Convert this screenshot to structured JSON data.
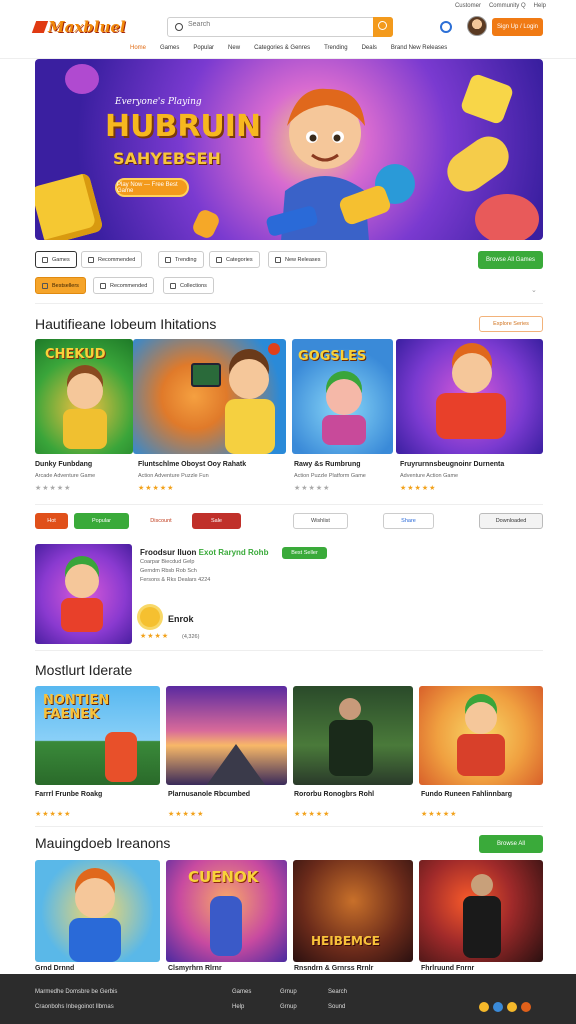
{
  "topbar": {
    "links": [
      "Customer",
      "Community Q",
      "Help"
    ]
  },
  "header": {
    "logo": "Maxbluel",
    "search_placeholder": "Search",
    "signup": "Sign Up / Login"
  },
  "nav": [
    "Home",
    "Games",
    "Popular",
    "New",
    "Categories & Genres",
    "Trending",
    "Deals",
    "Brand New Releases"
  ],
  "hero": {
    "kicker": "Everyone's Playing",
    "title": "HUBRUIN",
    "subtitle": "SAHYEBSEH",
    "cta": "Play Now — Free Best Game"
  },
  "chips_row1": [
    "Games",
    "Recommended",
    "Trending",
    "Categories",
    "New Releases"
  ],
  "chips_row2": [
    "Bestsellers",
    "Recommended",
    "Collections"
  ],
  "browse_all": "Browse All Games",
  "section1": {
    "title": "Hautifieane Iobeum Ihitations",
    "btn": "Explore Series",
    "cards": [
      {
        "title": "Dunky Funbdang",
        "sub": "Arcade Adventure Game",
        "rating": "★★★★★",
        "thumb": "CHEKUD"
      },
      {
        "title": "Fluntschlme Oboyst Ooy Rahatk",
        "sub": "Action Adventure Puzzle Fun",
        "rating": "★★★★★",
        "thumb": ""
      },
      {
        "title": "Rawy &s Rumbrung",
        "sub": "Action Puzzle Platform Game",
        "rating": "★★★★★",
        "thumb": "GOGSLES"
      },
      {
        "title": "Fruyrurnnsbeugnoinr Durnenta",
        "sub": "Adventure Action Game",
        "rating": "★★★★★",
        "thumb": ""
      }
    ]
  },
  "actions": [
    "Hot",
    "Popular",
    "Discount",
    "Sale",
    "Wishlist",
    "Share",
    "Downloaded"
  ],
  "featured": {
    "title": "Froodsur Iluon",
    "highlight": "Exot Rarynd Rohb",
    "badge": "Best Seller",
    "l1": "Coarpar Biecdud Gelp",
    "l2": "Gerndm Rbsb Rob Sch",
    "l3": "Fersons & Rks Dealars 4224",
    "sticker": "Enrok",
    "rating": "★★★★",
    "votes": "(4,326)"
  },
  "section2": {
    "title": "Mostlurt Iderate",
    "cards": [
      {
        "title": "Farrrl Frunbe Roakg",
        "rating": "★★★★★",
        "thumb": "NONTIEN FAENEK"
      },
      {
        "title": "Plarnusanole Rbcumbed",
        "rating": "★★★★★",
        "thumb": ""
      },
      {
        "title": "Rororbu Ronogbrs Rohl",
        "rating": "★★★★★",
        "thumb": ""
      },
      {
        "title": "Fundo Runeen Fahlinnbarg",
        "rating": "★★★★★",
        "thumb": ""
      }
    ]
  },
  "section3": {
    "title": "Mauingdoeb Ireanons",
    "btn": "Browse All",
    "cards": [
      {
        "title": "Grnd Drnnd",
        "thumb": ""
      },
      {
        "title": "Clsmyrhrn Rlrnr",
        "thumb": "CUENOK"
      },
      {
        "title": "Rnsndrn & Grnrss Rrnlr",
        "thumb": "HEIBEMCE"
      },
      {
        "title": "Fhrlruund Fnrnr",
        "thumb": ""
      }
    ]
  },
  "footer": {
    "lines": [
      "Marmedhe Domsbre be Gerbis",
      "Craonbohs Inbegoinot Ilbrnas"
    ],
    "links_a": [
      "Games",
      "Help"
    ],
    "links_b": [
      "Grnup",
      "Grnup"
    ],
    "links_c": [
      "Search",
      "Sound"
    ]
  },
  "colors": {
    "accent": "#f07a14",
    "green": "#3aaa3a",
    "purple": "#7a3ad0"
  }
}
